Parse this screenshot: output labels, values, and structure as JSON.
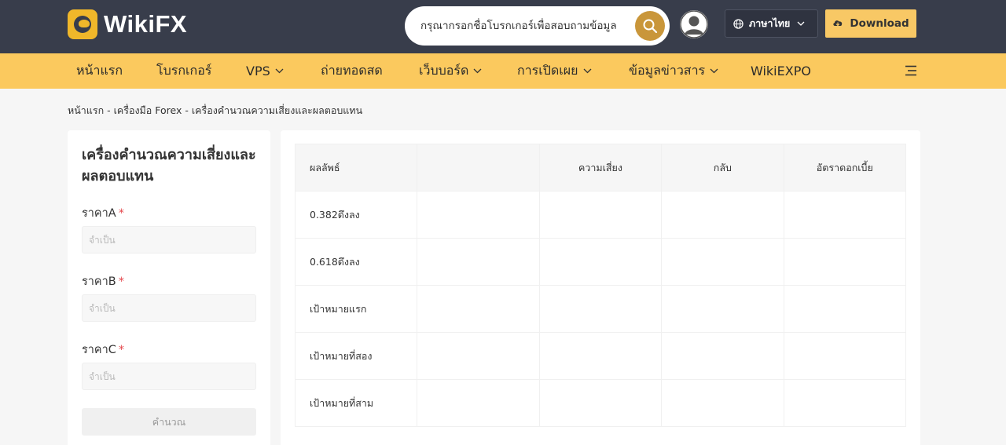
{
  "header": {
    "brand": "WikiFX",
    "search_placeholder": "กรุณากรอกชื่อโบรกเกอร์เพื่อสอบถามข้อมูล",
    "language": "ภาษาไทย",
    "download_label": "Download",
    "colors": {
      "header_bg": "#383d4b",
      "accent": "#fbc95e",
      "download_bg": "#f8c865",
      "search_btn": "#c9963a"
    }
  },
  "nav": {
    "items": [
      {
        "label": "หน้าแรก",
        "dropdown": false
      },
      {
        "label": "โบรกเกอร์",
        "dropdown": false
      },
      {
        "label": "VPS",
        "dropdown": true
      },
      {
        "label": "ถ่ายทอดสด",
        "dropdown": false
      },
      {
        "label": "เว็บบอร์ด",
        "dropdown": true
      },
      {
        "label": "การเปิดเผย",
        "dropdown": true
      },
      {
        "label": "ข้อมูลข่าวสาร",
        "dropdown": true
      },
      {
        "label": "WikiEXPO",
        "dropdown": false
      }
    ],
    "menu_icon": "hamburger-icon"
  },
  "breadcrumb": "หน้าแรก - เครื่องมือ Forex - เครื่องคำนวณความเสี่ยงและผลตอบแทน",
  "calculator": {
    "title": "เครื่องคำนวณความเสี่ยงและผลตอบแทน",
    "fields": [
      {
        "label": "ราคาA",
        "required": "*",
        "placeholder": "จำเป็น",
        "value": ""
      },
      {
        "label": "ราคาB",
        "required": "*",
        "placeholder": "จำเป็น",
        "value": ""
      },
      {
        "label": "ราคาC",
        "required": "*",
        "placeholder": "จำเป็น",
        "value": ""
      }
    ],
    "submit_label": "คำนวณ"
  },
  "results": {
    "headers": [
      "ผลลัพธ์",
      "",
      "ความเสี่ยง",
      "กลับ",
      "อัตราดอกเบี้ย"
    ],
    "rows": [
      {
        "label": "0.382ดึงลง"
      },
      {
        "label": "0.618ดึงลง"
      },
      {
        "label": "เป้าหมายแรก"
      },
      {
        "label": "เป้าหมายที่สอง"
      },
      {
        "label": "เป้าหมายที่สาม"
      }
    ]
  }
}
